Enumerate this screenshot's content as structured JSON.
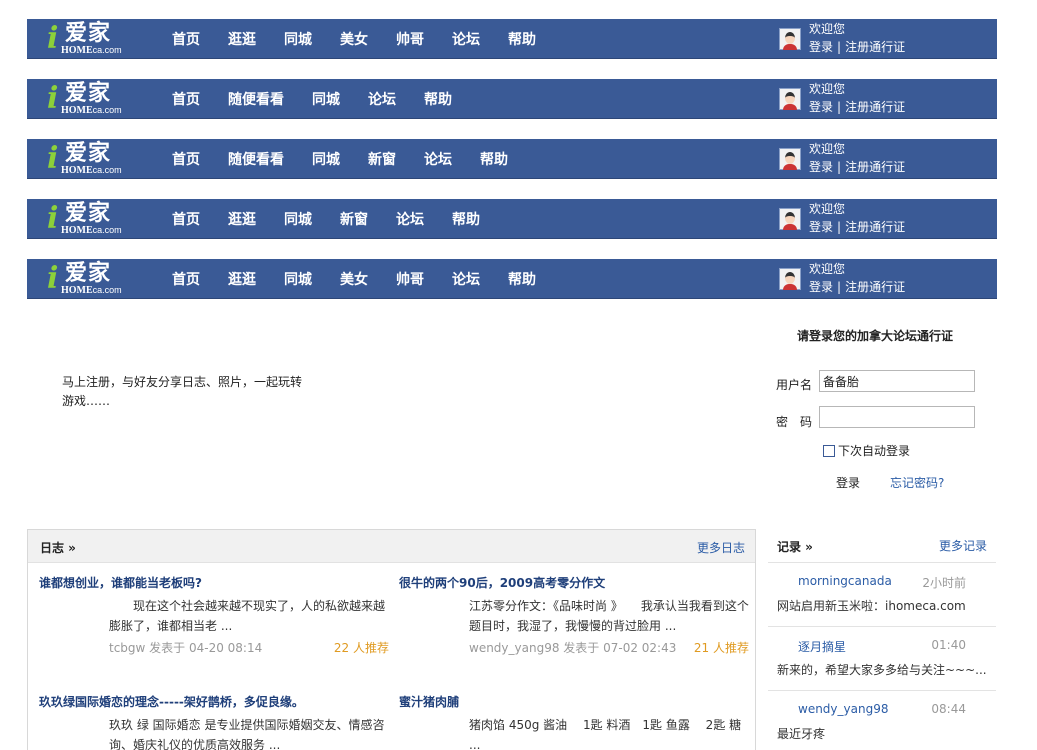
{
  "brand": {
    "logo_i": "i",
    "logo_cn": "爱家",
    "logo_en_main": "HOME",
    "logo_en_suffix": "ca.com"
  },
  "navbars": [
    {
      "items": [
        "首页",
        "逛逛",
        "同城",
        "美女",
        "帅哥",
        "论坛",
        "帮助"
      ]
    },
    {
      "items": [
        "首页",
        "随便看看",
        "同城",
        "论坛",
        "帮助"
      ]
    },
    {
      "items": [
        "首页",
        "随便看看",
        "同城",
        "新窗",
        "论坛",
        "帮助"
      ]
    },
    {
      "items": [
        "首页",
        "逛逛",
        "同城",
        "新窗",
        "论坛",
        "帮助"
      ]
    },
    {
      "items": [
        "首页",
        "逛逛",
        "同城",
        "美女",
        "帅哥",
        "论坛",
        "帮助"
      ]
    }
  ],
  "user": {
    "welcome": "欢迎您",
    "login": "登录",
    "separator": "|",
    "register": "注册通行证"
  },
  "promo": {
    "text": "马上注册，与好友分享日志、照片，一起玩转游戏……"
  },
  "login": {
    "title": "请登录您的加拿大论坛通行证",
    "username_label": "用户名",
    "username_value": "备备胎",
    "password_label": "密　码",
    "password_value": "",
    "remember": "下次自动登录",
    "submit": "登录",
    "forgot": "忘记密码?"
  },
  "blog": {
    "title": "日志 »",
    "more": "更多日志",
    "posts": [
      {
        "title": "谁都想创业，谁都能当老板吗?",
        "excerpt": "　　现在这个社会越来越不现实了，人的私欲越来越膨胀了，谁都相当老 ...",
        "meta": "tcbgw 发表于 04-20 08:14",
        "recommend": "22 人推荐"
      },
      {
        "title": "很牛的两个90后，2009高考零分作文",
        "excerpt": "江苏零分作文：《品味时尚 》　　我承认当我看到这个题目时，我湿了，我慢慢的背过脸用 ...",
        "meta": "wendy_yang98 发表于 07-02 02:43",
        "recommend": "21 人推荐"
      },
      {
        "title": "玖玖绿国际婚恋的理念-----架好鹊桥，多促良缘。",
        "excerpt": "玖玖 绿 国际婚恋 是专业提供国际婚姻交友、情感咨询、婚庆礼仪的优质高效服务 ...",
        "meta": "",
        "recommend": ""
      },
      {
        "title": "蜜汁猪肉脯",
        "excerpt": "猪肉馅 450g 酱油　 1匙 料酒　1匙 鱼露　 2匙 糖　 ...",
        "meta": "",
        "recommend": ""
      }
    ]
  },
  "records": {
    "title": "记录 »",
    "more": "更多记录",
    "items": [
      {
        "user": "morningcanada",
        "time": "2小时前",
        "content": "网站启用新玉米啦：ihomeca.com"
      },
      {
        "user": "逐月摘星",
        "time": "01:40",
        "content": "新来的，希望大家多多给与关注~~~..."
      },
      {
        "user": "wendy_yang98",
        "time": "08:44",
        "content": "最近牙疼"
      }
    ]
  },
  "colors": {
    "nav_bg": "#3a5a96",
    "logo_green": "#8cd13a",
    "link_blue": "#2b5ca6",
    "recommend_orange": "#e09b22"
  }
}
